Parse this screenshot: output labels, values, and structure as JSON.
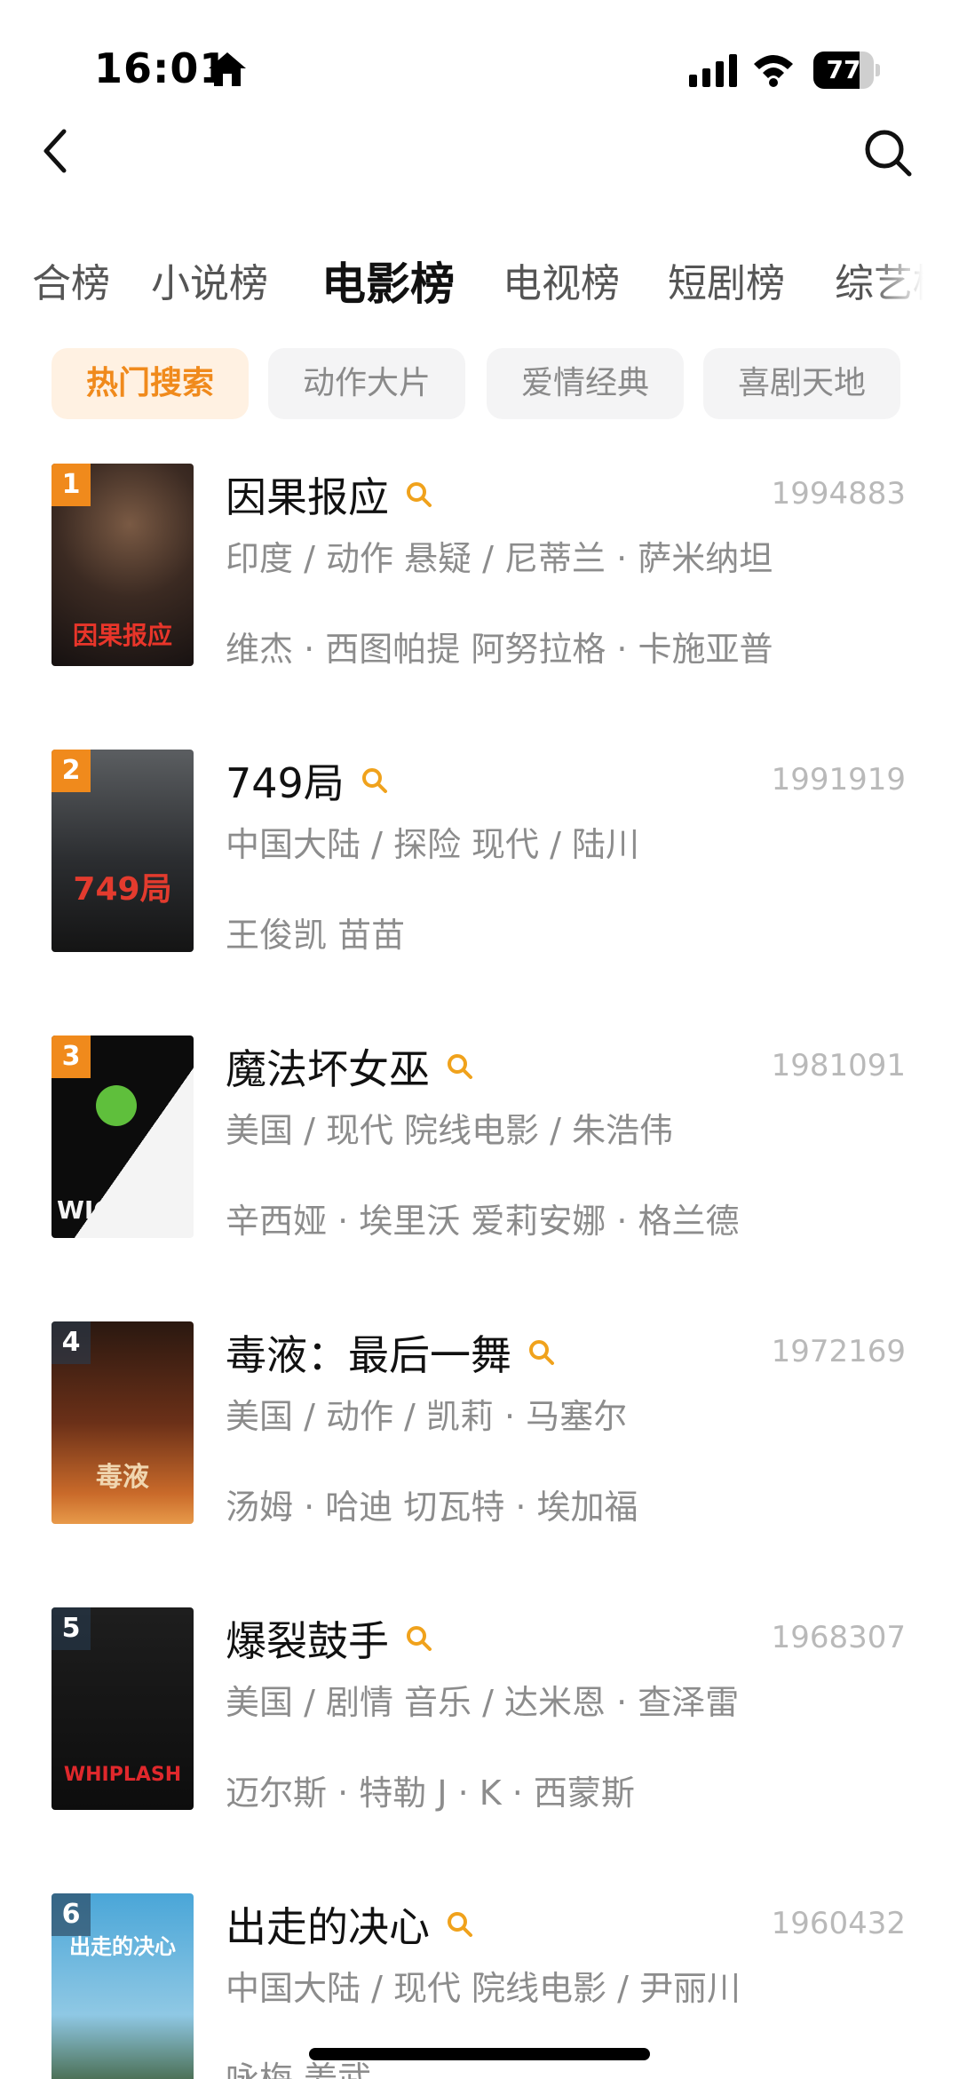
{
  "status_bar": {
    "time": "16:01",
    "battery": "77",
    "battery_level": 0.77
  },
  "nav": {
    "back_icon": "chevron-left-icon",
    "search_icon": "search-icon"
  },
  "tabs": [
    "合榜",
    "小说榜",
    "电影榜",
    "电视榜",
    "短剧榜",
    "综艺榜"
  ],
  "active_tab": "电影榜",
  "chips": [
    "热门搜索",
    "动作大片",
    "爱情经典",
    "喜剧天地"
  ],
  "active_chip": "热门搜索",
  "colors": {
    "accent": "#f08a1c",
    "chip_bg": "#f4f4f5",
    "chip_active_bg": "#fff1e2",
    "meta": "#8c8c8c"
  },
  "movies": [
    {
      "rank": "1",
      "title": "因果报应",
      "count": "1994883",
      "meta": "印度 / 动作 悬疑 / 尼蒂兰 · 萨米纳坦",
      "cast": "维杰 · 西图帕提 阿努拉格 · 卡施亚普",
      "poster_text": "因果报应"
    },
    {
      "rank": "2",
      "title": "749局",
      "count": "1991919",
      "meta": "中国大陆 / 探险 现代 / 陆川",
      "cast": "王俊凯 苗苗",
      "poster_text": "749局"
    },
    {
      "rank": "3",
      "title": "魔法坏女巫",
      "count": "1981091",
      "meta": "美国 / 现代 院线电影 / 朱浩伟",
      "cast": "辛西娅 · 埃里沃 爱莉安娜 · 格兰德",
      "poster_text": "WICKED"
    },
    {
      "rank": "4",
      "title": "毒液：最后一舞",
      "count": "1972169",
      "meta": "美国 / 动作 / 凯莉 · 马塞尔",
      "cast": "汤姆 · 哈迪  切瓦特 · 埃加福",
      "poster_text": "毒液"
    },
    {
      "rank": "5",
      "title": "爆裂鼓手",
      "count": "1968307",
      "meta": "美国 / 剧情 音乐 / 达米恩 · 查泽雷",
      "cast": "迈尔斯 · 特勒 J · K · 西蒙斯",
      "poster_text": "WHIPLASH"
    },
    {
      "rank": "6",
      "title": "出走的决心",
      "count": "1960432",
      "meta": "中国大陆 / 现代 院线电影 / 尹丽川",
      "cast": "咏梅 姜武",
      "poster_text": "出走的决心"
    }
  ]
}
